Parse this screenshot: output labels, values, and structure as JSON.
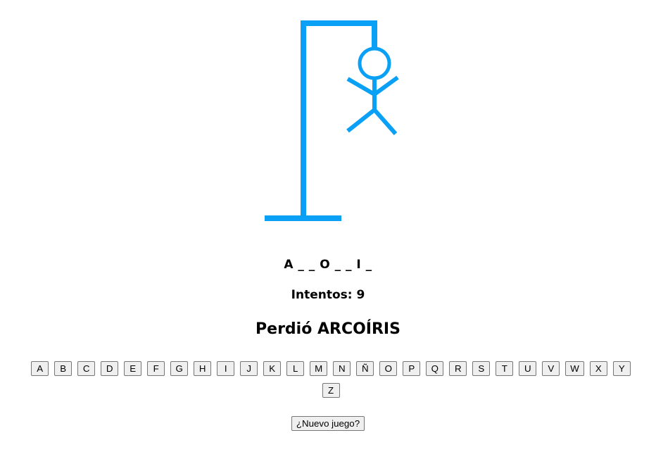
{
  "game": {
    "word_display": "A _ _ O _ _ I _",
    "attempts_text": "Intentos: 9",
    "result_text": "Perdió ARCOÍRIS",
    "accent_color": "#0aa0f5"
  },
  "keyboard": {
    "letters": [
      "A",
      "B",
      "C",
      "D",
      "E",
      "F",
      "G",
      "H",
      "I",
      "J",
      "K",
      "L",
      "M",
      "N",
      "Ñ",
      "O",
      "P",
      "Q",
      "R",
      "S",
      "T",
      "U",
      "V",
      "W",
      "X",
      "Y",
      "Z"
    ]
  },
  "actions": {
    "new_game_label": "¿Nuevo juego?"
  },
  "icons": {
    "drawing": "hangman-figure-icon"
  }
}
